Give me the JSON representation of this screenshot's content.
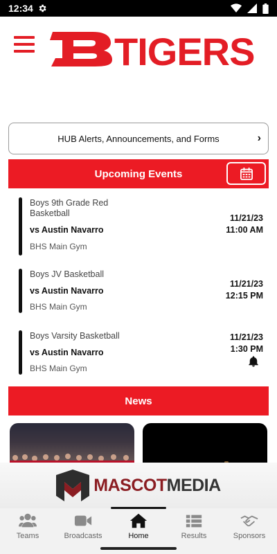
{
  "status_bar": {
    "time": "12:34"
  },
  "header": {
    "logo_text": "TIGERS",
    "logo_color": "#e31d25"
  },
  "alerts": {
    "label": "HUB Alerts, Announcements, and Forms"
  },
  "upcoming": {
    "title": "Upcoming Events"
  },
  "events": [
    {
      "title": "Boys 9th Grade Red Basketball",
      "opponent": "vs Austin Navarro",
      "location": "BHS Main Gym",
      "date": "11/21/23",
      "time": "11:00 AM",
      "has_bell": false
    },
    {
      "title": "Boys JV Basketball",
      "opponent": "vs Austin Navarro",
      "location": "BHS Main Gym",
      "date": "11/21/23",
      "time": "12:15 PM",
      "has_bell": false
    },
    {
      "title": "Boys Varsity Basketball",
      "opponent": "vs Austin Navarro",
      "location": "BHS Main Gym",
      "date": "11/21/23",
      "time": "1:30 PM",
      "has_bell": true
    }
  ],
  "news": {
    "title": "News"
  },
  "sponsor": {
    "part1": "MASCOT",
    "part2": "MEDIA"
  },
  "tabs": [
    {
      "label": "Teams",
      "icon": "people-icon"
    },
    {
      "label": "Broadcasts",
      "icon": "video-camera-icon"
    },
    {
      "label": "Home",
      "icon": "home-icon",
      "active": true
    },
    {
      "label": "Results",
      "icon": "list-icon"
    },
    {
      "label": "Sponsors",
      "icon": "handshake-icon"
    }
  ],
  "colors": {
    "accent": "#ec1b24",
    "brand_maroon": "#8b1d22"
  }
}
